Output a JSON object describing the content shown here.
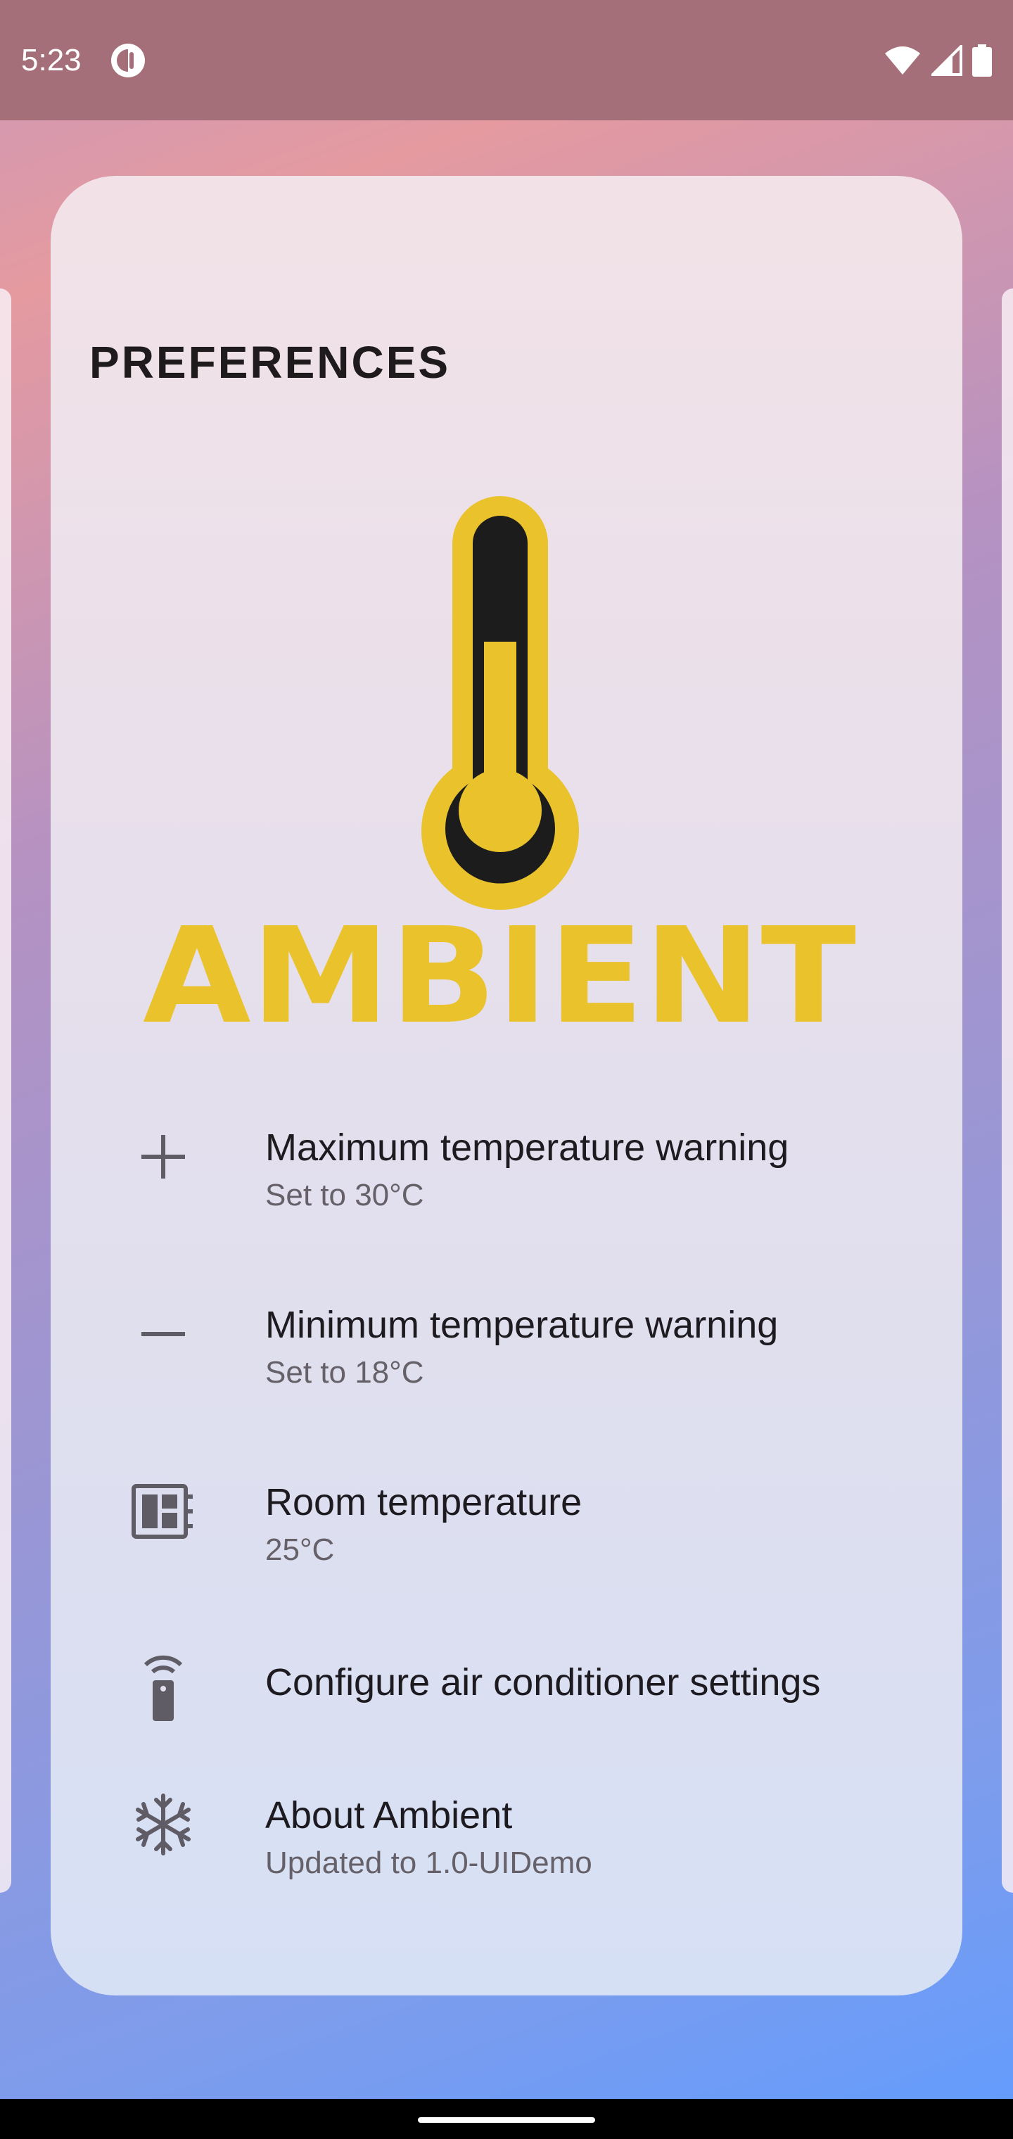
{
  "status_bar": {
    "time": "5:23",
    "app_icon": "ambient-app-icon",
    "wifi_icon": "wifi-icon",
    "signal_icon": "cellular-signal-icon",
    "battery_icon": "battery-icon"
  },
  "card": {
    "title": "PREFERENCES",
    "logo_text": "AMBIENT",
    "logo_icon": "thermometer-icon",
    "colors": {
      "logo_yellow": "#e9c22c",
      "logo_dark": "#1c1c1c"
    }
  },
  "preferences": [
    {
      "icon": "plus-icon",
      "title": "Maximum temperature warning",
      "subtitle": "Set to 30°C"
    },
    {
      "icon": "minus-icon",
      "title": "Minimum temperature warning",
      "subtitle": "Set to 18°C"
    },
    {
      "icon": "dashboard-icon",
      "title": "Room temperature",
      "subtitle": "25°C"
    },
    {
      "icon": "remote-control-icon",
      "title": "Configure air conditioner settings"
    },
    {
      "icon": "snowflake-icon",
      "title": "About Ambient",
      "subtitle": "Updated to 1.0-UIDemo"
    }
  ]
}
